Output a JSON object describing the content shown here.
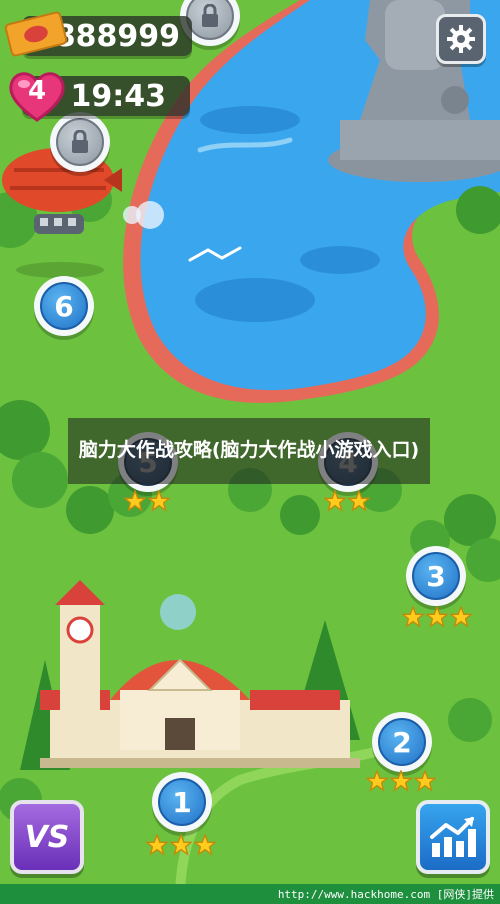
{
  "hud": {
    "coins": "888999",
    "lives": "4",
    "timer": "19:43"
  },
  "levels": [
    {
      "number": "1",
      "stars": 3
    },
    {
      "number": "2",
      "stars": 3
    },
    {
      "number": "3",
      "stars": 3
    },
    {
      "number": "4",
      "stars": 2
    },
    {
      "number": "5",
      "stars": 2
    },
    {
      "number": "6",
      "stars": 0
    }
  ],
  "banner": {
    "text": "脑力大作战攻略(脑力大作战小游戏入口)"
  },
  "buttons": {
    "vs_label": "VS"
  },
  "footer": {
    "text": "http://www.hackhome.com [网侠]提供"
  },
  "colors": {
    "grass": "#6cc23e",
    "water": "#3aa6ee",
    "node_blue": "#2272c8",
    "star": "#ffcc1e",
    "settings_bg": "#5a6470"
  },
  "icons": {
    "coins": "ticket-icon",
    "lives": "heart-icon",
    "settings": "gear-icon",
    "vs": "vs-icon",
    "stats": "chart-up-icon",
    "locked": "lock-icon"
  }
}
